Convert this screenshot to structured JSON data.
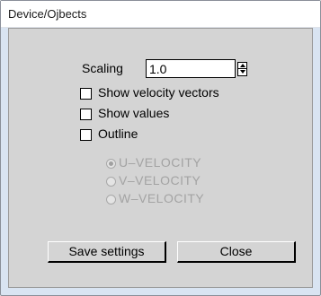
{
  "window": {
    "title": "Device/Ojbects"
  },
  "scaling": {
    "label": "Scaling",
    "value": "1.0"
  },
  "options": {
    "show_velocity_vectors": {
      "label": "Show velocity vectors",
      "checked": false
    },
    "show_values": {
      "label": "Show values",
      "checked": false
    },
    "outline": {
      "label": "Outline",
      "checked": false
    }
  },
  "velocity_component": {
    "enabled": false,
    "selected": "U-VELOCITY",
    "items": [
      {
        "label": "U–VELOCITY"
      },
      {
        "label": "V–VELOCITY"
      },
      {
        "label": "W–VELOCITY"
      }
    ]
  },
  "buttons": {
    "save_label": "Save settings",
    "close_label": "Close"
  }
}
